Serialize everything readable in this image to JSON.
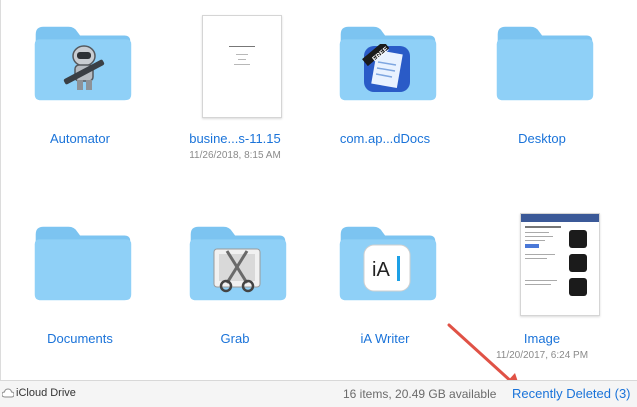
{
  "files": [
    {
      "name": "Automator",
      "date": "",
      "kind": "folder",
      "badge_icon": "automator-robot-icon"
    },
    {
      "name": "busine...s-11.15",
      "date": "11/26/2018, 8:15 AM",
      "kind": "document"
    },
    {
      "name": "com.ap...dDocs",
      "date": "",
      "kind": "folder",
      "badge_icon": "free-app-icon",
      "badge_text": "FREE"
    },
    {
      "name": "Desktop",
      "date": "",
      "kind": "folder"
    },
    {
      "name": "Documents",
      "date": "",
      "kind": "folder"
    },
    {
      "name": "Grab",
      "date": "",
      "kind": "folder",
      "badge_icon": "grab-scissors-icon"
    },
    {
      "name": "iA Writer",
      "date": "",
      "kind": "folder",
      "badge_icon": "ia-writer-icon",
      "badge_text": "iA"
    },
    {
      "name": "Image",
      "date": "11/20/2017, 6:24 PM",
      "kind": "image"
    }
  ],
  "status": {
    "location": "iCloud Drive",
    "items_info": "16 items, 20.49 GB available",
    "recently_deleted": "Recently Deleted (3)"
  },
  "colors": {
    "folder_front": "#8fd0f7",
    "folder_tab": "#7cc4f1",
    "link_blue": "#1a73d9",
    "arrow_red": "#e05246"
  }
}
